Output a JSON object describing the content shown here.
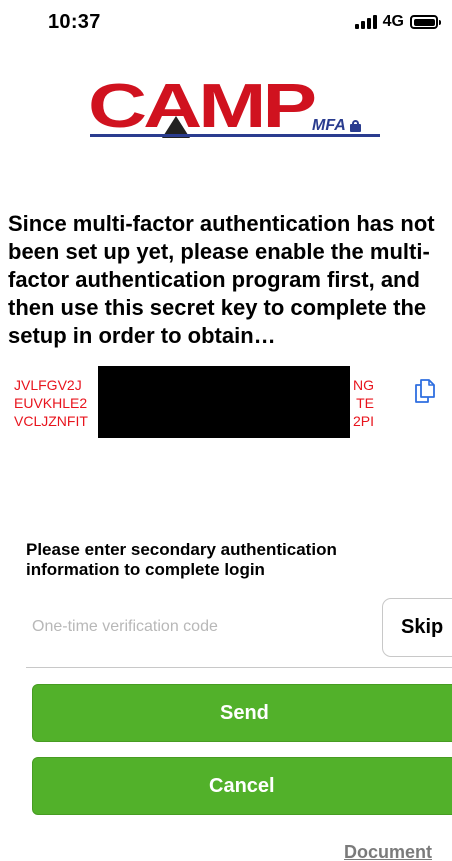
{
  "status_bar": {
    "time": "10:37",
    "network": "4G"
  },
  "logo": {
    "wordmark": "CAMP",
    "suffix": "MFA",
    "colors": {
      "wordmark": "#d0121f",
      "suffix": "#2a3c8f"
    }
  },
  "intro_text": "Since multi-factor authentication has not been set up yet, please enable the multi-factor authentication program first, and then use this secret key to complete the setup in order to obtain…",
  "secret_key": {
    "lines": [
      {
        "start": "JVLFGV2J",
        "end": "NG"
      },
      {
        "start": "EUVKHLE2",
        "end": "TE"
      },
      {
        "start": "VCLJZNFIT",
        "end": "2PI"
      }
    ],
    "color": "#e8141d",
    "copy_icon": "copy-icon"
  },
  "login": {
    "prompt": "Please enter secondary authentication information to complete login",
    "otp_placeholder": "One-time verification code",
    "skip_label": "Skip",
    "send_label": "Send",
    "cancel_label": "Cancel",
    "button_color": "#52b12a"
  },
  "footer": {
    "document_link": "Document"
  }
}
